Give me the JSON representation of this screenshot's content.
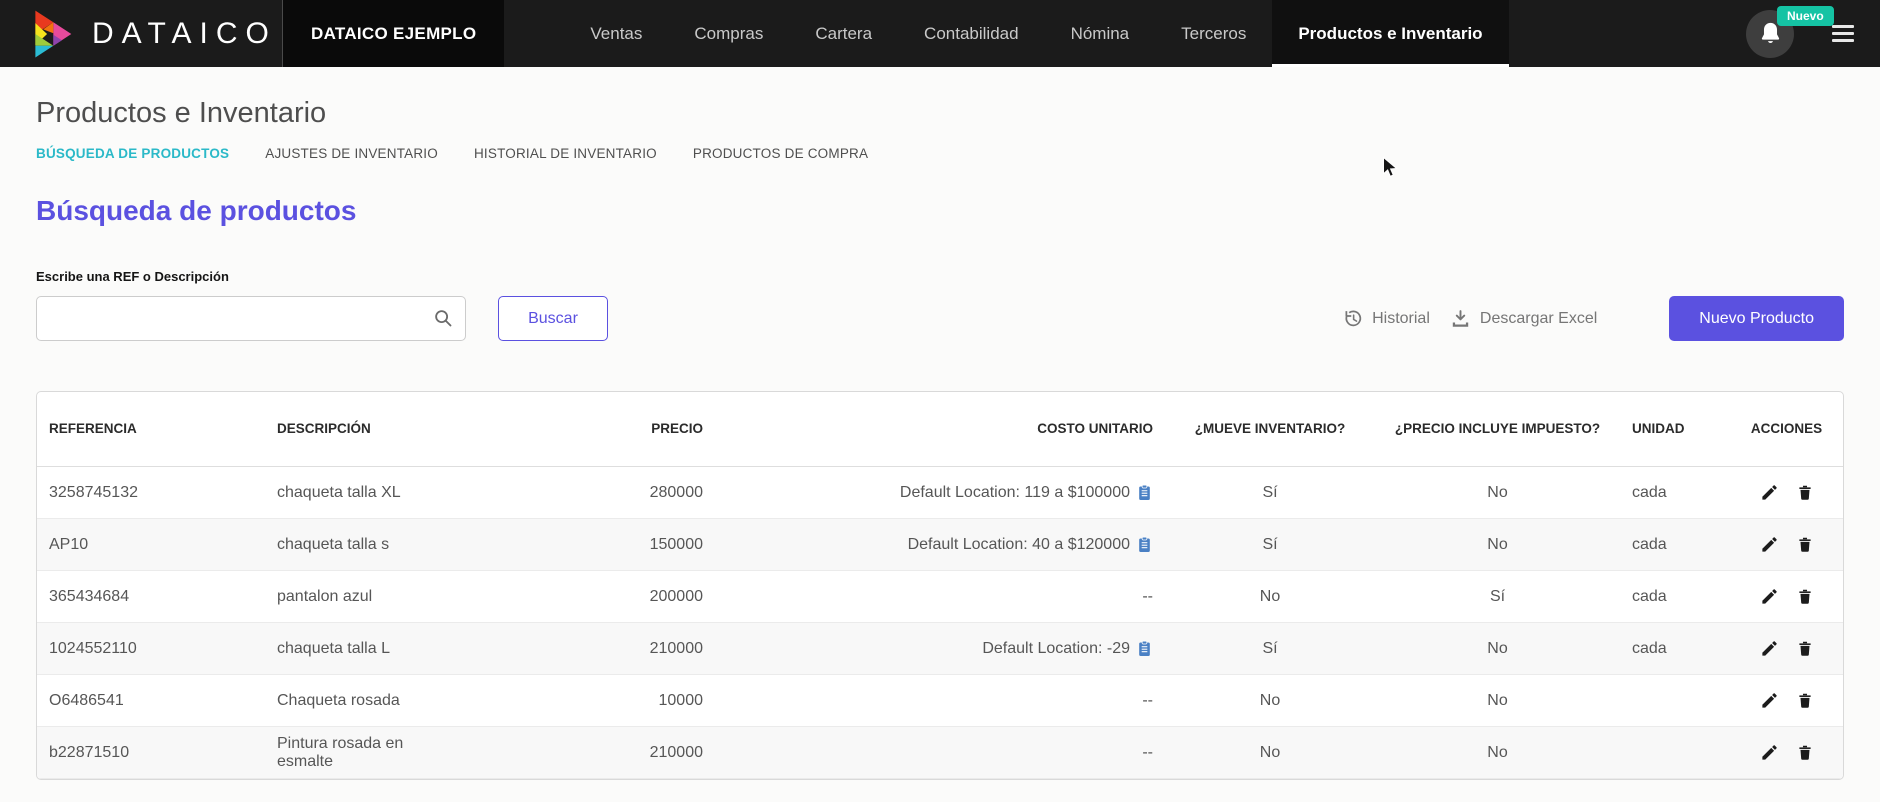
{
  "navbar": {
    "brand": "DATAICO",
    "company": "DATAICO EJEMPLO",
    "items": [
      {
        "label": "Ventas",
        "active": false
      },
      {
        "label": "Compras",
        "active": false
      },
      {
        "label": "Cartera",
        "active": false
      },
      {
        "label": "Contabilidad",
        "active": false
      },
      {
        "label": "Nómina",
        "active": false
      },
      {
        "label": "Terceros",
        "active": false
      },
      {
        "label": "Productos e Inventario",
        "active": true
      }
    ],
    "notification_badge": "Nuevo"
  },
  "page": {
    "title": "Productos e Inventario",
    "tabs": [
      {
        "label": "BÚSQUEDA DE PRODUCTOS",
        "active": true
      },
      {
        "label": "AJUSTES DE INVENTARIO",
        "active": false
      },
      {
        "label": "HISTORIAL DE INVENTARIO",
        "active": false
      },
      {
        "label": "PRODUCTOS DE COMPRA",
        "active": false
      }
    ],
    "section_title": "Búsqueda de productos",
    "search_label": "Escribe una REF o Descripción",
    "search_value": "",
    "buscar_label": "Buscar",
    "historial_label": "Historial",
    "descargar_label": "Descargar Excel",
    "nuevo_producto_label": "Nuevo Producto"
  },
  "table": {
    "headers": [
      "REFERENCIA",
      "DESCRIPCIÓN",
      "PRECIO",
      "COSTO UNITARIO",
      "¿MUEVE INVENTARIO?",
      "¿PRECIO INCLUYE IMPUESTO?",
      "UNIDAD",
      "ACCIONES"
    ],
    "rows": [
      {
        "referencia": "3258745132",
        "descripcion": "chaqueta talla XL",
        "precio": "280000",
        "costo": "Default Location: 119 a $100000",
        "costo_icon": true,
        "mueve": "Sí",
        "impuesto": "No",
        "unidad": "cada"
      },
      {
        "referencia": "AP10",
        "descripcion": "chaqueta talla s",
        "precio": "150000",
        "costo": "Default Location: 40 a $120000",
        "costo_icon": true,
        "mueve": "Sí",
        "impuesto": "No",
        "unidad": "cada"
      },
      {
        "referencia": "365434684",
        "descripcion": "pantalon azul",
        "precio": "200000",
        "costo": "--",
        "costo_icon": false,
        "mueve": "No",
        "impuesto": "Sí",
        "unidad": "cada"
      },
      {
        "referencia": "1024552110",
        "descripcion": "chaqueta talla L",
        "precio": "210000",
        "costo": "Default Location: -29",
        "costo_icon": true,
        "mueve": "Sí",
        "impuesto": "No",
        "unidad": "cada"
      },
      {
        "referencia": "O6486541",
        "descripcion": "Chaqueta rosada",
        "precio": "10000",
        "costo": "--",
        "costo_icon": false,
        "mueve": "No",
        "impuesto": "No",
        "unidad": ""
      },
      {
        "referencia": "b22871510",
        "descripcion": "Pintura rosada en esmalte",
        "precio": "210000",
        "costo": "--",
        "costo_icon": false,
        "mueve": "No",
        "impuesto": "No",
        "unidad": ""
      }
    ]
  },
  "colors": {
    "accent_purple": "#5b51e0",
    "accent_teal": "#2bb9c8",
    "badge_teal": "#15c3a4",
    "clipboard_blue": "#4a80c4",
    "navbar_bg": "#1b1b1b"
  }
}
